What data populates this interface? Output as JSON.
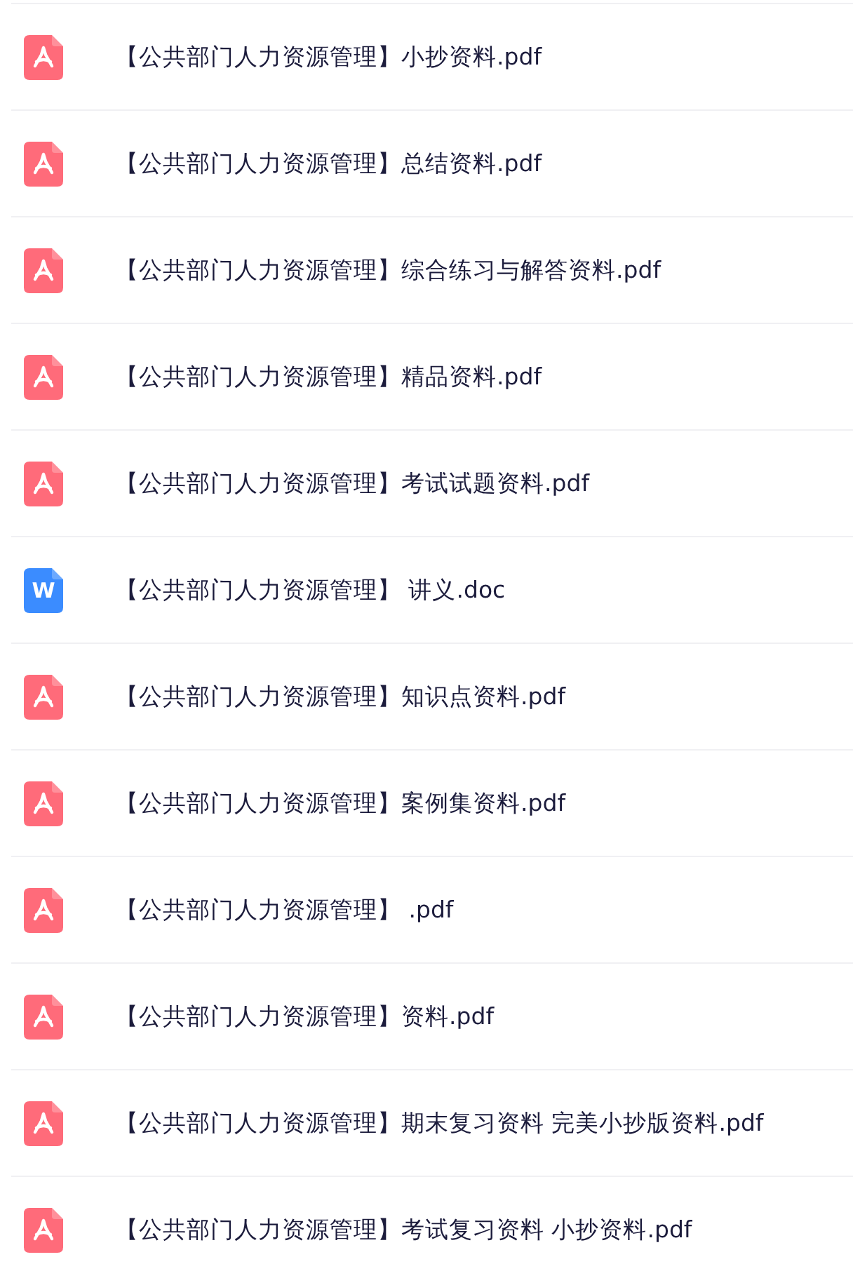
{
  "files": [
    {
      "kind": "pdf",
      "name": "【公共部门人力资源管理】小抄资料.pdf"
    },
    {
      "kind": "pdf",
      "name": "【公共部门人力资源管理】总结资料.pdf"
    },
    {
      "kind": "pdf",
      "name": "【公共部门人力资源管理】综合练习与解答资料.pdf"
    },
    {
      "kind": "pdf",
      "name": "【公共部门人力资源管理】精品资料.pdf"
    },
    {
      "kind": "pdf",
      "name": "【公共部门人力资源管理】考试试题资料.pdf"
    },
    {
      "kind": "doc",
      "icon_letter": "W",
      "name": "【公共部门人力资源管理】 讲义.doc"
    },
    {
      "kind": "pdf",
      "name": "【公共部门人力资源管理】知识点资料.pdf"
    },
    {
      "kind": "pdf",
      "name": "【公共部门人力资源管理】案例集资料.pdf"
    },
    {
      "kind": "pdf",
      "name": "【公共部门人力资源管理】 .pdf"
    },
    {
      "kind": "pdf",
      "name": "【公共部门人力资源管理】资料.pdf"
    },
    {
      "kind": "pdf",
      "name": "【公共部门人力资源管理】期末复习资料 完美小抄版资料.pdf"
    },
    {
      "kind": "pdf",
      "name": "【公共部门人力资源管理】考试复习资料 小抄资料.pdf"
    }
  ]
}
